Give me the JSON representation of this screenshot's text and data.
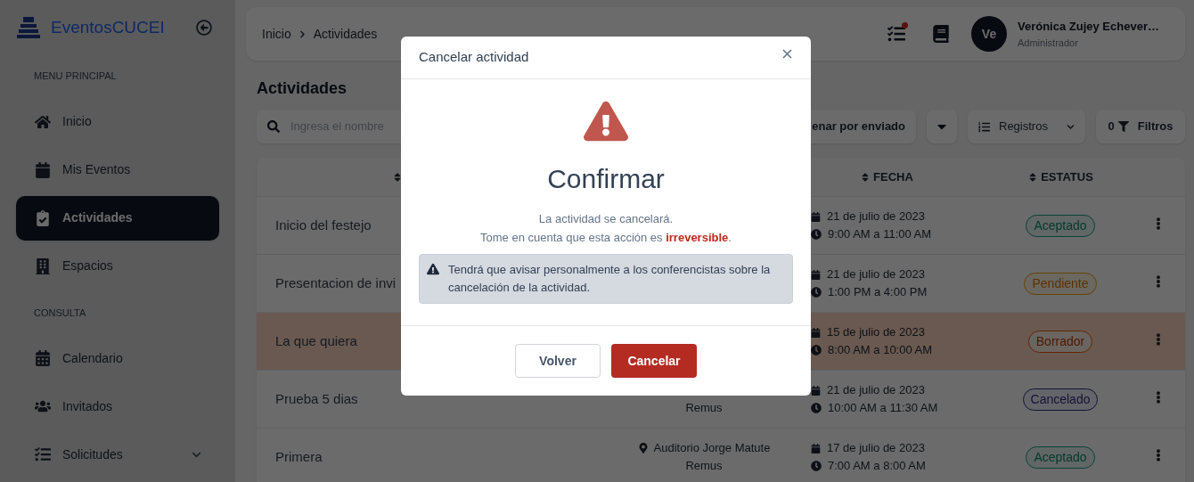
{
  "sidebar": {
    "brand": "EventosCUCEI",
    "sections": [
      {
        "title": "MENU PRINCIPAL",
        "items": [
          {
            "label": "Inicio",
            "selected": false
          },
          {
            "label": "Mis Eventos",
            "selected": false
          },
          {
            "label": "Actividades",
            "selected": true
          },
          {
            "label": "Espacios",
            "selected": false
          }
        ]
      },
      {
        "title": "CONSULTA",
        "items": [
          {
            "label": "Calendario",
            "selected": false
          },
          {
            "label": "Invitados",
            "selected": false
          },
          {
            "label": "Solicitudes",
            "selected": false,
            "expanded": false
          }
        ]
      }
    ]
  },
  "topbar": {
    "breadcrumb": [
      "Inicio",
      "Actividades"
    ],
    "has_notification": true,
    "user": {
      "initials": "Ve",
      "name": "Verónica Zujey Echever…",
      "role": "Administrador"
    }
  },
  "page_title": "Actividades",
  "toolbar": {
    "search": {
      "placeholder": "Ingresa el nombre"
    },
    "sort_button": "enar por enviado",
    "records_button": "Registros",
    "filters": {
      "count": "0",
      "label": "Filtros"
    }
  },
  "table": {
    "columns": [
      {
        "label": "FECHA"
      },
      {
        "label": "ESTATUS"
      }
    ],
    "rows": [
      {
        "name": "Inicio del festejo",
        "date": "21 de julio de 2023",
        "time": "9:00 AM a 11:00 AM",
        "status": "Aceptado",
        "kind": "accepted",
        "highlighted": false
      },
      {
        "name": "Presentacion de invi",
        "date": "21 de julio de 2023",
        "time": "1:00 PM a 4:00 PM",
        "status": "Pendiente",
        "kind": "pending",
        "highlighted": false
      },
      {
        "name": "La que quiera",
        "date": "15 de julio de 2023",
        "time": "8:00 AM a 10:00 AM",
        "status": "Borrador",
        "kind": "draft",
        "highlighted": true
      },
      {
        "name": "Prueba 5 dias",
        "location": [
          "Remus"
        ],
        "date": "21 de julio de 2023",
        "time": "10:00 AM a 11:30 AM",
        "status": "Cancelado",
        "kind": "cancelled",
        "highlighted": false
      },
      {
        "name": "Primera",
        "location": [
          "Auditorio Jorge Matute",
          "Remus"
        ],
        "date": "17 de julio de 2023",
        "time": "7:00 AM a 8:00 AM",
        "status": "Aceptado",
        "kind": "accepted",
        "highlighted": false
      }
    ]
  },
  "modal": {
    "title": "Cancelar actividad",
    "heading": "Confirmar",
    "message": [
      "La actividad se cancelará.",
      "Tome en cuenta que esta acción es **irreversible**."
    ],
    "alert": "Tendrá que avisar personalmente a los conferencistas sobre la cancelación de la actividad.",
    "buttons": [
      {
        "label": "Volver",
        "kind": "secondary"
      },
      {
        "label": "Cancelar",
        "kind": "danger"
      }
    ]
  }
}
